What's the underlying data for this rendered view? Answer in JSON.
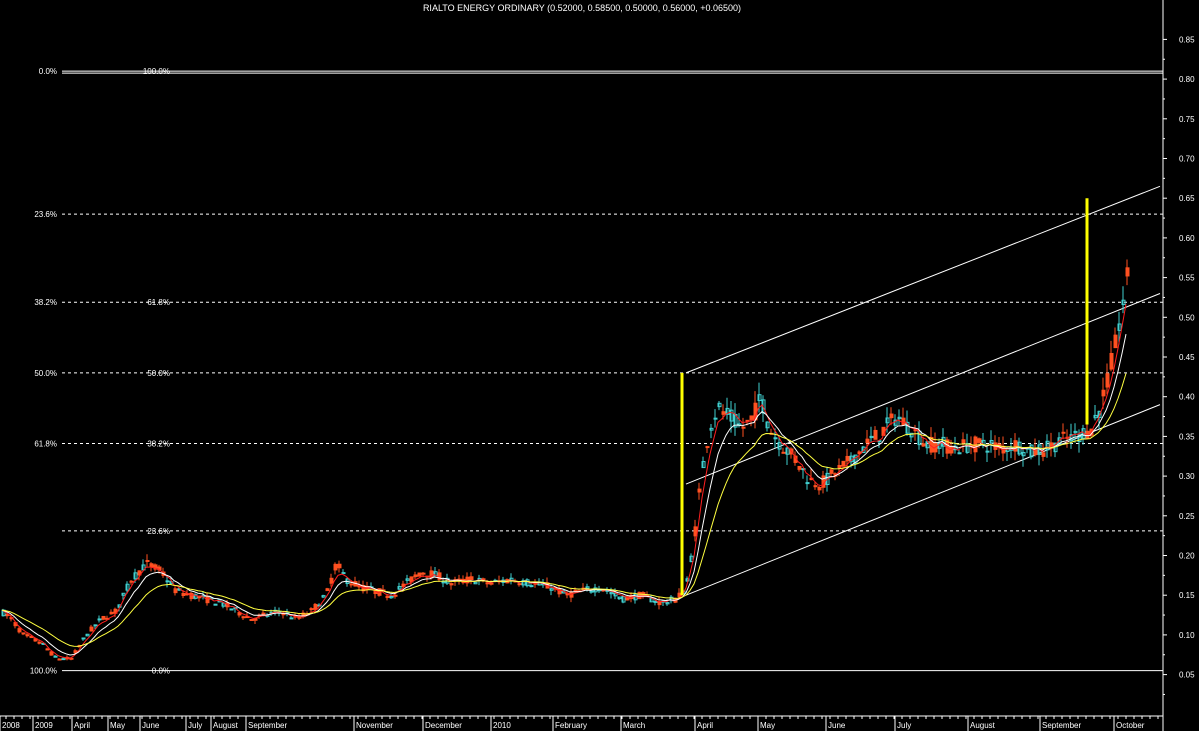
{
  "chart_data": {
    "type": "candlestick",
    "title": "RIALTO ENERGY ORDINARY (0.52000, 0.58500, 0.50000, 0.56000, +0.06500)",
    "y_axis": {
      "ylim": [
        0.0,
        0.86
      ],
      "ticks": [
        0.05,
        0.1,
        0.15,
        0.2,
        0.25,
        0.3,
        0.35,
        0.4,
        0.45,
        0.5,
        0.55,
        0.6,
        0.65,
        0.7,
        0.75,
        0.8,
        0.85
      ],
      "tick_labels": [
        "0.05",
        "0.10",
        "0.15",
        "0.20",
        "0.25",
        "0.30",
        "0.35",
        "0.40",
        "0.45",
        "0.50",
        "0.55",
        "0.60",
        "0.65",
        "0.70",
        "0.75",
        "0.80",
        "0.85"
      ],
      "position": "right"
    },
    "x_axis": {
      "labels": [
        {
          "t": 0,
          "label": "2008"
        },
        {
          "t": 33,
          "label": "2009"
        },
        {
          "t": 72,
          "label": "April"
        },
        {
          "t": 108,
          "label": "May"
        },
        {
          "t": 140,
          "label": "June"
        },
        {
          "t": 186,
          "label": "July"
        },
        {
          "t": 211,
          "label": "August"
        },
        {
          "t": 246,
          "label": "September"
        },
        {
          "t": 354,
          "label": "November"
        },
        {
          "t": 423,
          "label": "December"
        },
        {
          "t": 491,
          "label": "2010"
        },
        {
          "t": 553,
          "label": "February"
        },
        {
          "t": 621,
          "label": "March"
        },
        {
          "t": 695,
          "label": "April"
        },
        {
          "t": 758,
          "label": "May"
        },
        {
          "t": 826,
          "label": "June"
        },
        {
          "t": 895,
          "label": "July"
        },
        {
          "t": 968,
          "label": "August"
        },
        {
          "t": 1040,
          "label": "September"
        },
        {
          "t": 1114,
          "label": "October"
        }
      ]
    },
    "fib_levels_left": [
      {
        "label": "0.0%",
        "value": 0.81
      },
      {
        "label": "23.6%",
        "value": 0.63
      },
      {
        "label": "38.2%",
        "value": 0.519
      },
      {
        "label": "50.0%",
        "value": 0.43
      },
      {
        "label": "61.8%",
        "value": 0.341
      },
      {
        "label": "100.0%",
        "value": 0.055
      }
    ],
    "fib_levels_inner": [
      {
        "label": "100.0%",
        "value": 0.81
      },
      {
        "label": "61.8%",
        "value": 0.519
      },
      {
        "label": "50.0%",
        "value": 0.43
      },
      {
        "label": "38.2%",
        "value": 0.341
      },
      {
        "label": "23.6%",
        "value": 0.231
      },
      {
        "label": "0.0%",
        "value": 0.055
      }
    ],
    "channel_lines": [
      {
        "t1": 686,
        "v1": 0.43,
        "t2": 1160,
        "v2": 0.665
      },
      {
        "t1": 686,
        "v1": 0.29,
        "t2": 1160,
        "v2": 0.53
      },
      {
        "t1": 686,
        "v1": 0.15,
        "t2": 1160,
        "v2": 0.39
      }
    ],
    "vertical_markers": [
      {
        "t": 682,
        "v_low": 0.15,
        "v_high": 0.43,
        "color": "#ffff00"
      },
      {
        "t": 1087,
        "v_low": 0.365,
        "v_high": 0.65,
        "color": "#ffff00"
      }
    ],
    "price_path": [
      [
        0,
        0.13
      ],
      [
        10,
        0.12
      ],
      [
        22,
        0.1
      ],
      [
        40,
        0.09
      ],
      [
        55,
        0.07
      ],
      [
        70,
        0.07
      ],
      [
        85,
        0.1
      ],
      [
        100,
        0.12
      ],
      [
        115,
        0.13
      ],
      [
        130,
        0.17
      ],
      [
        145,
        0.19
      ],
      [
        160,
        0.18
      ],
      [
        175,
        0.155
      ],
      [
        190,
        0.15
      ],
      [
        205,
        0.145
      ],
      [
        220,
        0.14
      ],
      [
        235,
        0.13
      ],
      [
        250,
        0.12
      ],
      [
        265,
        0.125
      ],
      [
        280,
        0.13
      ],
      [
        295,
        0.12
      ],
      [
        310,
        0.13
      ],
      [
        325,
        0.15
      ],
      [
        335,
        0.19
      ],
      [
        345,
        0.17
      ],
      [
        360,
        0.16
      ],
      [
        375,
        0.155
      ],
      [
        390,
        0.15
      ],
      [
        405,
        0.165
      ],
      [
        420,
        0.18
      ],
      [
        435,
        0.175
      ],
      [
        450,
        0.165
      ],
      [
        470,
        0.17
      ],
      [
        490,
        0.165
      ],
      [
        510,
        0.17
      ],
      [
        530,
        0.165
      ],
      [
        550,
        0.16
      ],
      [
        565,
        0.15
      ],
      [
        580,
        0.155
      ],
      [
        600,
        0.16
      ],
      [
        620,
        0.145
      ],
      [
        640,
        0.15
      ],
      [
        660,
        0.14
      ],
      [
        675,
        0.145
      ],
      [
        685,
        0.16
      ],
      [
        693,
        0.22
      ],
      [
        700,
        0.3
      ],
      [
        708,
        0.36
      ],
      [
        716,
        0.385
      ],
      [
        728,
        0.375
      ],
      [
        740,
        0.36
      ],
      [
        750,
        0.37
      ],
      [
        760,
        0.4
      ],
      [
        768,
        0.36
      ],
      [
        780,
        0.34
      ],
      [
        795,
        0.32
      ],
      [
        808,
        0.295
      ],
      [
        820,
        0.29
      ],
      [
        835,
        0.305
      ],
      [
        850,
        0.32
      ],
      [
        865,
        0.34
      ],
      [
        880,
        0.355
      ],
      [
        895,
        0.375
      ],
      [
        910,
        0.36
      ],
      [
        925,
        0.34
      ],
      [
        940,
        0.34
      ],
      [
        955,
        0.335
      ],
      [
        970,
        0.34
      ],
      [
        985,
        0.34
      ],
      [
        1000,
        0.335
      ],
      [
        1015,
        0.34
      ],
      [
        1030,
        0.33
      ],
      [
        1045,
        0.335
      ],
      [
        1060,
        0.345
      ],
      [
        1075,
        0.35
      ],
      [
        1090,
        0.36
      ],
      [
        1100,
        0.39
      ],
      [
        1108,
        0.43
      ],
      [
        1115,
        0.47
      ],
      [
        1122,
        0.52
      ],
      [
        1128,
        0.56
      ]
    ],
    "moving_averages": [
      {
        "color": "#ff2020",
        "lag": 0.45
      },
      {
        "color": "#ffffff",
        "lag": 0.25
      },
      {
        "color": "#ffff40",
        "lag": 0.12
      }
    ],
    "candle_colors": {
      "up": "#40d0d0",
      "down": "#ff5020"
    },
    "grid": false,
    "legend": "none"
  }
}
